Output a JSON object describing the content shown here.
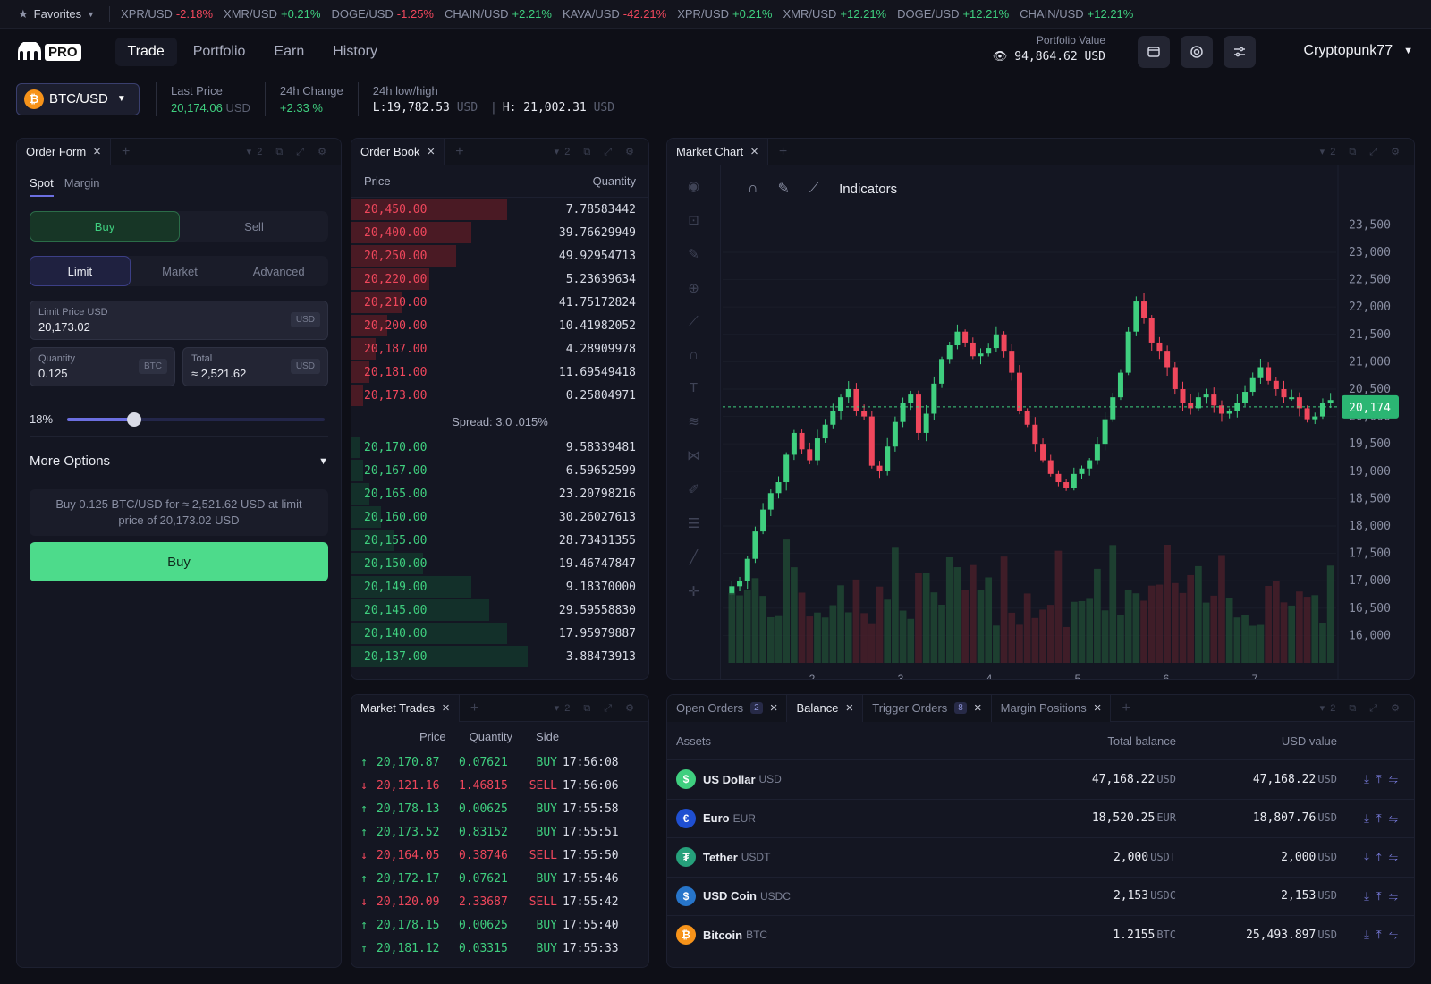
{
  "ticker": {
    "favorites": "Favorites",
    "items": [
      {
        "pair": "XPR/USD",
        "change": "-2.18%",
        "dir": "down"
      },
      {
        "pair": "XMR/USD",
        "change": "+0.21%",
        "dir": "up"
      },
      {
        "pair": "DOGE/USD",
        "change": "-1.25%",
        "dir": "down"
      },
      {
        "pair": "CHAIN/USD",
        "change": "+2.21%",
        "dir": "up"
      },
      {
        "pair": "KAVA/USD",
        "change": "-42.21%",
        "dir": "down"
      },
      {
        "pair": "XPR/USD",
        "change": "+0.21%",
        "dir": "up"
      },
      {
        "pair": "XMR/USD",
        "change": "+12.21%",
        "dir": "up"
      },
      {
        "pair": "DOGE/USD",
        "change": "+12.21%",
        "dir": "up"
      },
      {
        "pair": "CHAIN/USD",
        "change": "+12.21%",
        "dir": "up"
      }
    ]
  },
  "nav": {
    "logo_pro": "PRO",
    "links": [
      "Trade",
      "Portfolio",
      "Earn",
      "History"
    ],
    "active": "Trade",
    "portfolio_label": "Portfolio Value",
    "portfolio_value": "94,864.62 USD",
    "user": "Cryptopunk77"
  },
  "pair": {
    "name": "BTC/USD",
    "last_price_label": "Last Price",
    "last_price": "20,174.06",
    "last_price_unit": "USD",
    "change_label": "24h Change",
    "change": "+2.33 %",
    "lh_label": "24h low/high",
    "low": "L:19,782.53",
    "low_unit": "USD",
    "high": "H: 21,002.31",
    "high_unit": "USD"
  },
  "order_form": {
    "title": "Order Form",
    "tabs": [
      "Spot",
      "Margin"
    ],
    "buy": "Buy",
    "sell": "Sell",
    "types": [
      "Limit",
      "Market",
      "Advanced"
    ],
    "limit_label": "Limit Price USD",
    "limit_value": "20,173.02",
    "limit_unit": "USD",
    "qty_label": "Quantity",
    "qty_value": "0.125",
    "qty_unit": "BTC",
    "total_label": "Total",
    "total_value": "≈ 2,521.62",
    "total_unit": "USD",
    "slider_pct_label": "18%",
    "slider_value": 0.18,
    "more_options": "More Options",
    "summary": "Buy 0.125 BTC/USD for ≈ 2,521.62 USD at limit price of 20,173.02 USD",
    "submit": "Buy"
  },
  "order_book": {
    "title": "Order Book",
    "price_h": "Price",
    "qty_h": "Quantity",
    "spread": "Spread: 3.0 .015%",
    "asks": [
      [
        "20,450.00",
        "7.78583442",
        0.52
      ],
      [
        "20,400.00",
        "39.76629949",
        0.4
      ],
      [
        "20,250.00",
        "49.92954713",
        0.35
      ],
      [
        "20,220.00",
        "5.23639634",
        0.26
      ],
      [
        "20,210.00",
        "41.75172824",
        0.17
      ],
      [
        "20,200.00",
        "10.41982052",
        0.12
      ],
      [
        "20,187.00",
        "4.28909978",
        0.08
      ],
      [
        "20,181.00",
        "11.69549418",
        0.06
      ],
      [
        "20,173.00",
        "0.25804971",
        0.04
      ]
    ],
    "bids": [
      [
        "20,170.00",
        "9.58339481",
        0.03
      ],
      [
        "20,167.00",
        "6.59652599",
        0.04
      ],
      [
        "20,165.00",
        "23.20798216",
        0.06
      ],
      [
        "20,160.00",
        "30.26027613",
        0.1
      ],
      [
        "20,155.00",
        "28.73431355",
        0.14
      ],
      [
        "20,150.00",
        "19.46747847",
        0.24
      ],
      [
        "20,149.00",
        "9.18370000",
        0.4
      ],
      [
        "20,145.00",
        "29.59558830",
        0.46
      ],
      [
        "20,140.00",
        "17.95979887",
        0.52
      ],
      [
        "20,137.00",
        "3.88473913",
        0.59
      ]
    ]
  },
  "market_trades": {
    "title": "Market Trades",
    "price_h": "Price",
    "qty_h": "Quantity",
    "side_h": "Side",
    "rows": [
      [
        "20,170.87",
        "0.07621",
        "BUY",
        "17:56:08"
      ],
      [
        "20,121.16",
        "1.46815",
        "SELL",
        "17:56:06"
      ],
      [
        "20,178.13",
        "0.00625",
        "BUY",
        "17:55:58"
      ],
      [
        "20,173.52",
        "0.83152",
        "BUY",
        "17:55:51"
      ],
      [
        "20,164.05",
        "0.38746",
        "SELL",
        "17:55:50"
      ],
      [
        "20,172.17",
        "0.07621",
        "BUY",
        "17:55:46"
      ],
      [
        "20,120.09",
        "2.33687",
        "SELL",
        "17:55:42"
      ],
      [
        "20,178.15",
        "0.00625",
        "BUY",
        "17:55:40"
      ],
      [
        "20,181.12",
        "0.03315",
        "BUY",
        "17:55:33"
      ]
    ]
  },
  "chart": {
    "title": "Market Chart",
    "indicators": "Indicators",
    "current_label": "20,174"
  },
  "chart_data": {
    "type": "candlestick",
    "x_ticks": [
      "2",
      "3",
      "4",
      "5",
      "6",
      "7"
    ],
    "y_ticks": [
      "23,500",
      "23,000",
      "22,500",
      "22,000",
      "21,500",
      "21,000",
      "20,500",
      "20,000",
      "19,500",
      "19,000",
      "18,500",
      "18,000",
      "17,500",
      "17,000",
      "16,500",
      "16,000"
    ],
    "ylim": [
      15500,
      23800
    ],
    "current_price": 20174,
    "close_path": [
      16900,
      17000,
      17400,
      17900,
      18300,
      18600,
      18800,
      19300,
      19700,
      19400,
      19200,
      19600,
      19850,
      20100,
      20350,
      20500,
      20100,
      20000,
      19100,
      19000,
      19450,
      19900,
      20250,
      20400,
      19700,
      20050,
      20600,
      21050,
      21300,
      21550,
      21350,
      21100,
      21150,
      21250,
      21500,
      21200,
      20800,
      20100,
      19850,
      19500,
      19200,
      18950,
      18800,
      18700,
      18950,
      19050,
      19200,
      19500,
      19950,
      20350,
      20800,
      21550,
      22100,
      21800,
      21350,
      21200,
      20900,
      20500,
      20250,
      20150,
      20350,
      20400,
      20200,
      20050,
      20100,
      20250,
      20450,
      20700,
      20900,
      20650,
      20500,
      20350,
      20350,
      20150,
      19950,
      20000,
      20250,
      20300
    ]
  },
  "bottom": {
    "tabs": [
      {
        "label": "Open Orders",
        "badge": "2"
      },
      {
        "label": "Balance",
        "badge": ""
      },
      {
        "label": "Trigger Orders",
        "badge": "8"
      },
      {
        "label": "Margin Positions",
        "badge": ""
      }
    ],
    "h_assets": "Assets",
    "h_total": "Total balance",
    "h_usd": "USD value",
    "rows": [
      {
        "name": "US Dollar",
        "sym": "USD",
        "total": "47,168.22",
        "tunit": "USD",
        "usd": "47,168.22",
        "uunit": "USD",
        "color": "#3fcf7f",
        "glyph": "$"
      },
      {
        "name": "Euro",
        "sym": "EUR",
        "total": "18,520.25",
        "tunit": "EUR",
        "usd": "18,807.76",
        "uunit": "USD",
        "color": "#1f4fd1",
        "glyph": "€"
      },
      {
        "name": "Tether",
        "sym": "USDT",
        "total": "2,000",
        "tunit": "USDT",
        "usd": "2,000",
        "uunit": "USD",
        "color": "#26a17b",
        "glyph": "₮"
      },
      {
        "name": "USD Coin",
        "sym": "USDC",
        "total": "2,153",
        "tunit": "USDC",
        "usd": "2,153",
        "uunit": "USD",
        "color": "#2775ca",
        "glyph": "$"
      },
      {
        "name": "Bitcoin",
        "sym": "BTC",
        "total": "1.2155",
        "tunit": "BTC",
        "usd": "25,493.897",
        "uunit": "USD",
        "color": "#f7931a",
        "glyph": "₿"
      }
    ]
  }
}
